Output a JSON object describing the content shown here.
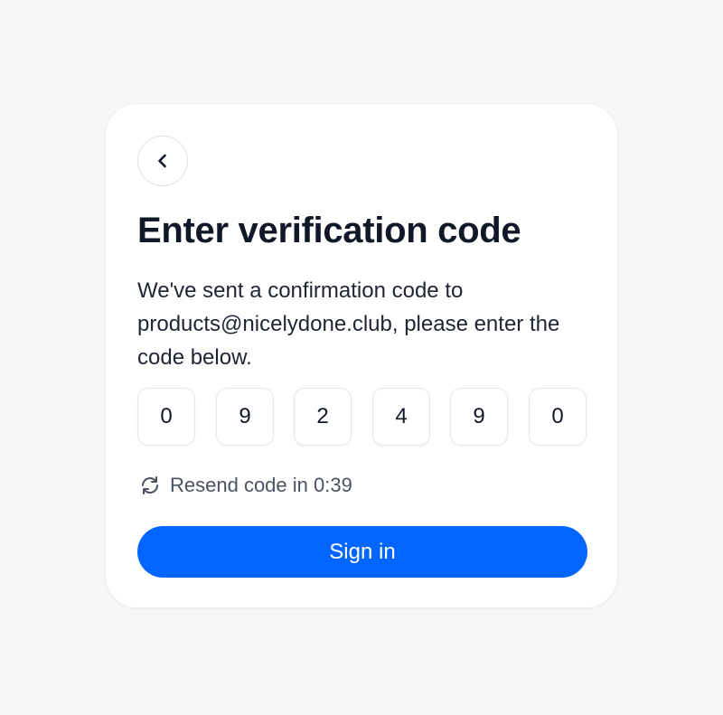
{
  "heading": {
    "title": "Enter verification code",
    "description": "We've sent a confirmation code to products@nicelydone.club, please enter the code below."
  },
  "navigation": {
    "back_icon": "chevron-left-icon"
  },
  "code_inputs": [
    "0",
    "9",
    "2",
    "4",
    "9",
    "0"
  ],
  "resend": {
    "icon": "refresh-icon",
    "text": "Resend code in 0:39"
  },
  "actions": {
    "sign_in_label": "Sign in"
  },
  "colors": {
    "accent": "#0066ff",
    "background": "#f6f7f9",
    "card": "#ffffff",
    "text": "#111827"
  }
}
